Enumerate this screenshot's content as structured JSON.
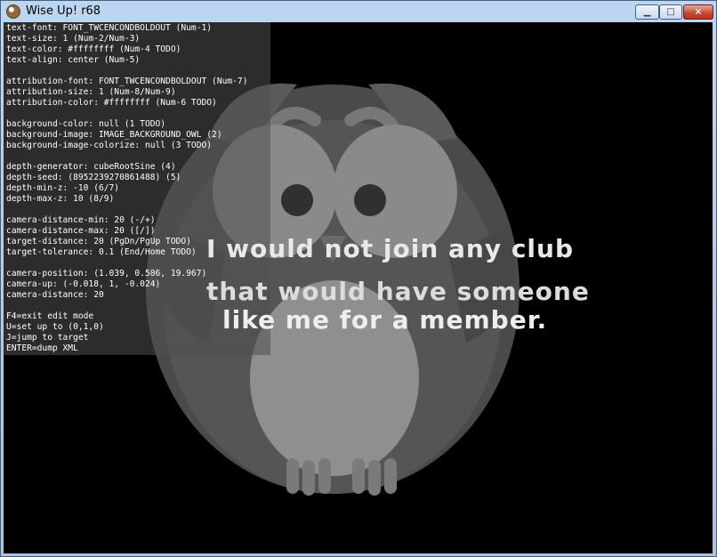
{
  "window": {
    "title": "Wise Up! r68",
    "minimize_glyph": "▁",
    "maximize_glyph": "□",
    "close_glyph": "✕",
    "app_icon": "owl-icon"
  },
  "hud_lines": [
    "text-font: FONT_TWCENCONDBOLDOUT (Num-1)",
    "text-size: 1 (Num-2/Num-3)",
    "text-color: #ffffffff (Num-4 TODO)",
    "text-align: center (Num-5)",
    "",
    "attribution-font: FONT_TWCENCONDBOLDOUT (Num-7)",
    "attribution-size: 1 (Num-8/Num-9)",
    "attribution-color: #ffffffff (Num-6 TODO)",
    "",
    "background-color: null (1 TODO)",
    "background-image: IMAGE_BACKGROUND_OWL (2)",
    "background-image-colorize: null (3 TODO)",
    "",
    "depth-generator: cubeRootSine (4)",
    "depth-seed: (8952239270861488) (5)",
    "depth-min-z: -10 (6/7)",
    "depth-max-z: 10 (8/9)",
    "",
    "camera-distance-min: 20 (-/+)",
    "camera-distance-max: 20 ([/])",
    "target-distance: 20 (PgDn/PgUp TODO)",
    "target-tolerance: 0.1 (End/Home TODO)",
    "",
    "camera-position: (1.039, 0.506, 19.967)",
    "camera-up: (-0.018, 1, -0.024)",
    "camera-distance: 20",
    "",
    "F4=exit edit mode",
    "U=set up to (0,1,0)",
    "J=jump to target",
    "ENTER=dump XML"
  ],
  "quote": {
    "line1": "I would not join any club",
    "line2": "that would have someone",
    "line3": "like me for a member."
  },
  "colors": {
    "titlebar_top": "#bcd6f1",
    "client_bg": "#000000",
    "hud_text": "#ffffff",
    "close_button": "#c44731"
  }
}
